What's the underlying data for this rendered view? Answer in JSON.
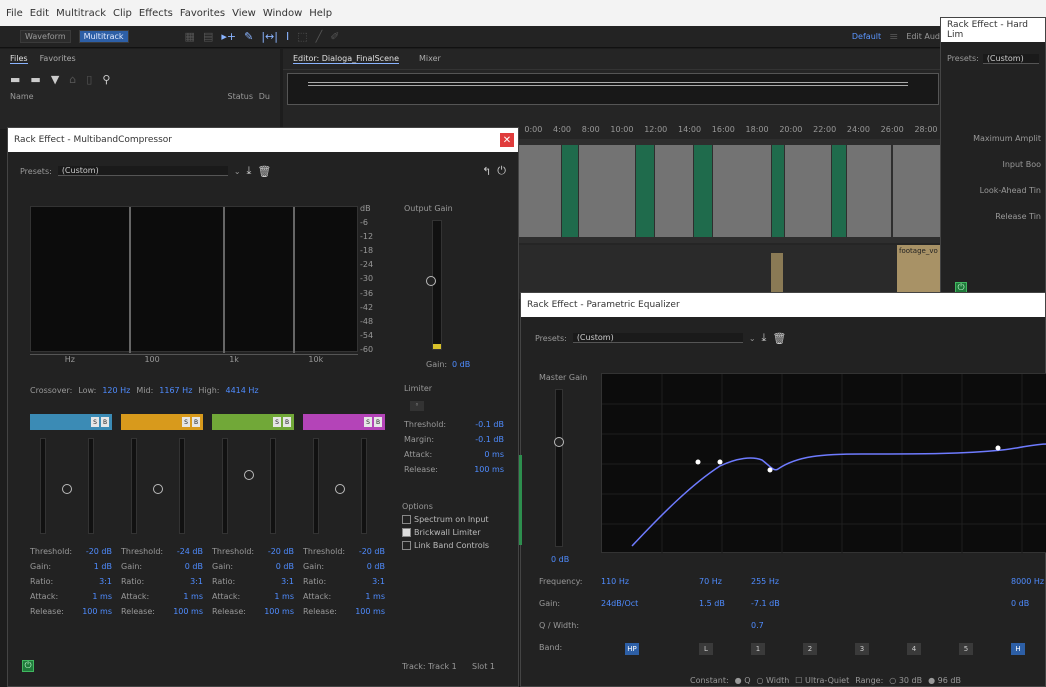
{
  "menu": [
    "File",
    "Edit",
    "Multitrack",
    "Clip",
    "Effects",
    "Favorites",
    "View",
    "Window",
    "Help"
  ],
  "toolbar": {
    "waveform": "Waveform",
    "multitrack": "Multitrack",
    "default": "Default",
    "edit_audio": "Edit Aud"
  },
  "files_panel": {
    "tab_files": "Files",
    "tab_favorites": "Favorites",
    "col_name": "Name",
    "col_status": "Status",
    "col_du": "Du"
  },
  "editor": {
    "tab": "Editor: Dialoga_FinalScene",
    "tab_mixer": "Mixer",
    "ruler": [
      "0:00",
      "4:00",
      "8:00",
      "10:00",
      "12:00",
      "14:00",
      "16:00",
      "18:00",
      "20:00",
      "22:00",
      "24:00",
      "26:00",
      "28:00"
    ],
    "clip_label": "footage_vo"
  },
  "mbc": {
    "title": "Rack Effect - MultibandCompressor",
    "presets_label": "Presets:",
    "preset_value": "(Custom)",
    "db_scale": [
      "dB",
      "-6",
      "-12",
      "-18",
      "-24",
      "-30",
      "-36",
      "-42",
      "-48",
      "-54",
      "-60"
    ],
    "freq_axis": [
      "Hz",
      "100",
      "1k",
      "10k"
    ],
    "output_gain_label": "Output Gain",
    "output_gain_value": "0 dB",
    "gain_label": "Gain:",
    "crossover_label": "Crossover:",
    "low_label": "Low:",
    "low_value": "120 Hz",
    "mid_label": "Mid:",
    "mid_value": "1167 Hz",
    "high_label": "High:",
    "high_value": "4414 Hz",
    "limiter": {
      "label": "Limiter",
      "threshold_label": "Threshold:",
      "threshold_value": "-0.1 dB",
      "margin_label": "Margin:",
      "margin_value": "-0.1 dB",
      "attack_label": "Attack:",
      "attack_value": "0 ms",
      "release_label": "Release:",
      "release_value": "100 ms"
    },
    "options": {
      "label": "Options",
      "spectrum": "Spectrum on Input",
      "brickwall": "Brickwall Limiter",
      "link": "Link Band Controls"
    },
    "bands": [
      {
        "color": "#3b8bb5",
        "threshold": "-20 dB",
        "gain": "1 dB",
        "ratio": "3:1",
        "attack": "1 ms",
        "release": "100 ms"
      },
      {
        "color": "#d89a1c",
        "threshold": "-24 dB",
        "gain": "0 dB",
        "ratio": "3:1",
        "attack": "1 ms",
        "release": "100 ms"
      },
      {
        "color": "#71a838",
        "threshold": "-20 dB",
        "gain": "0 dB",
        "ratio": "3:1",
        "attack": "1 ms",
        "release": "100 ms"
      },
      {
        "color": "#b444b8",
        "threshold": "-20 dB",
        "gain": "0 dB",
        "ratio": "3:1",
        "attack": "1 ms",
        "release": "100 ms"
      }
    ],
    "band_labels": {
      "threshold": "Threshold:",
      "gain": "Gain:",
      "ratio": "Ratio:",
      "attack": "Attack:",
      "release": "Release:"
    },
    "track": "Track: Track 1",
    "slot": "Slot 1"
  },
  "peq": {
    "title": "Rack Effect - Parametric Equalizer",
    "presets_label": "Presets:",
    "preset_value": "(Custom)",
    "master_gain_label": "Master Gain",
    "master_gain_value": "0 dB",
    "freq_label": "Frequency:",
    "gain_label": "Gain:",
    "q_label": "Q / Width:",
    "band_label": "Band:",
    "freq_values": [
      "110 Hz",
      "70 Hz",
      "255 Hz",
      "",
      "",
      "",
      "",
      "8000 Hz"
    ],
    "gain_values": [
      "24dB/Oct",
      "1.5 dB",
      "-7.1 dB",
      "",
      "",
      "",
      "",
      "0 dB"
    ],
    "q_values": [
      "",
      "",
      "0.7",
      "",
      "",
      "",
      "",
      ""
    ],
    "bands": [
      "HP",
      "L",
      "1",
      "2",
      "3",
      "4",
      "5",
      "H"
    ],
    "footer": {
      "constant": "Constant:",
      "q": "Q",
      "width": "Width",
      "ultra_quiet": "Ultra-Quiet",
      "range": "Range:",
      "range_30": "30 dB",
      "range_96": "96 dB"
    }
  },
  "hard_limiter": {
    "title": "Rack Effect - Hard Lim",
    "presets_label": "Presets:",
    "preset_value": "(Custom)",
    "rows": [
      "Maximum Amplit",
      "Input Boo",
      "Look-Ahead Tin",
      "Release Tin"
    ]
  }
}
